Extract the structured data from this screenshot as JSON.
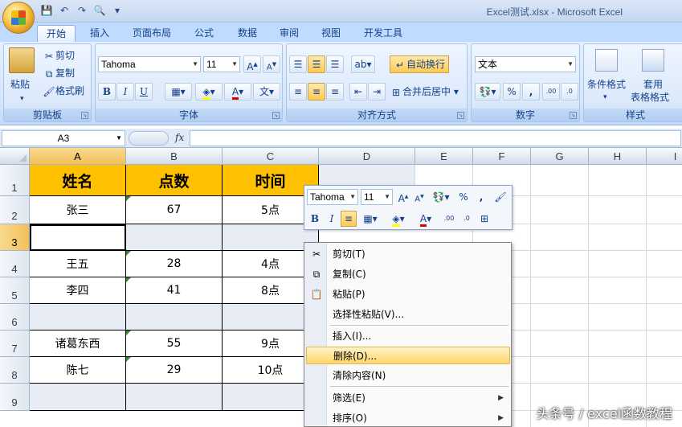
{
  "window": {
    "title": "Excel测试.xlsx - Microsoft Excel"
  },
  "tabs": [
    "开始",
    "插入",
    "页面布局",
    "公式",
    "数据",
    "审阅",
    "视图",
    "开发工具"
  ],
  "ribbon": {
    "clipboard": {
      "label": "剪贴板",
      "paste": "粘贴",
      "cut": "剪切",
      "copy": "复制",
      "format_painter": "格式刷"
    },
    "font": {
      "label": "字体",
      "name": "Tahoma",
      "size": "11",
      "bold": "B",
      "italic": "I",
      "underline": "U",
      "phonetic": "文"
    },
    "alignment": {
      "label": "对齐方式",
      "wrap": "自动换行",
      "merge": "合并后居中"
    },
    "number": {
      "label": "数字",
      "format": "文本",
      "percent": "%",
      "comma": ","
    },
    "styles": {
      "label": "样式",
      "conditional": "条件格式",
      "table_format_1": "套用",
      "table_format_2": "表格格式"
    }
  },
  "formula_bar": {
    "name_box": "A3",
    "fx": "fx",
    "value": ""
  },
  "sheet": {
    "columns": [
      "A",
      "B",
      "C",
      "D",
      "E",
      "F",
      "G",
      "H",
      "I"
    ],
    "rows": [
      "1",
      "2",
      "3",
      "4",
      "5",
      "6",
      "7",
      "8",
      "9"
    ],
    "header": [
      "姓名",
      "点数",
      "时间"
    ],
    "data": [
      [
        "张三",
        "67",
        "5点"
      ],
      [
        "",
        "",
        ""
      ],
      [
        "王五",
        "28",
        "4点"
      ],
      [
        "李四",
        "41",
        "8点"
      ],
      [
        "",
        "",
        ""
      ],
      [
        "诸葛东西",
        "55",
        "9点"
      ],
      [
        "陈七",
        "29",
        "10点"
      ],
      [
        "",
        "",
        ""
      ]
    ]
  },
  "mini_toolbar": {
    "font": "Tahoma",
    "size": "11",
    "bold": "B",
    "italic": "I",
    "font_color": "A"
  },
  "context_menu": {
    "items": [
      {
        "label": "剪切(T)"
      },
      {
        "label": "复制(C)"
      },
      {
        "label": "粘贴(P)"
      },
      {
        "label": "选择性粘贴(V)..."
      },
      {
        "label": "插入(I)..."
      },
      {
        "label": "删除(D)..."
      },
      {
        "label": "清除内容(N)"
      },
      {
        "label": "筛选(E)"
      },
      {
        "label": "排序(O)"
      }
    ]
  },
  "watermark": "头条号 / excel函数教程"
}
